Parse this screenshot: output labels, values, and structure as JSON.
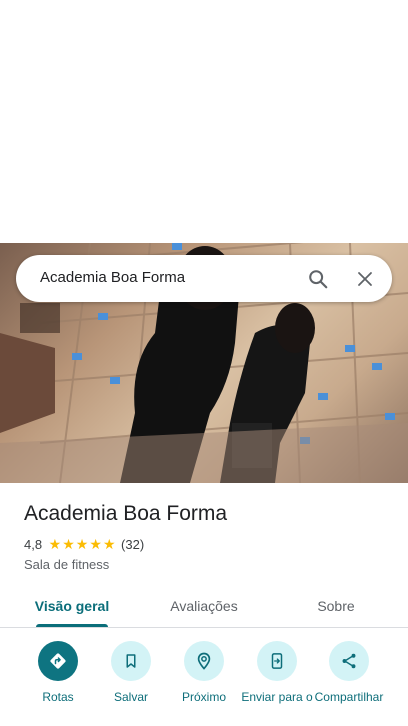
{
  "search": {
    "query": "Academia Boa Forma"
  },
  "place": {
    "name": "Academia Boa Forma",
    "rating": "4,8",
    "stars_count": 5,
    "review_count": "(32)",
    "category": "Sala de fitness"
  },
  "tabs": [
    {
      "label": "Visão geral",
      "active": true
    },
    {
      "label": "Avaliações",
      "active": false
    },
    {
      "label": "Sobre",
      "active": false
    }
  ],
  "actions": [
    {
      "label": "Rotas",
      "icon": "directions-icon",
      "primary": true
    },
    {
      "label": "Salvar",
      "icon": "bookmark-icon",
      "primary": false
    },
    {
      "label": "Próximo",
      "icon": "nearby-icon",
      "primary": false
    },
    {
      "label": "Enviar para o",
      "icon": "send-to-phone-icon",
      "primary": false
    },
    {
      "label": "Compartilhar",
      "icon": "share-icon",
      "primary": false
    }
  ],
  "colors": {
    "accent": "#0b6e7a",
    "action_bg": "#d3f3f6",
    "primary_action_bg": "#0e7481",
    "star": "#fbbc04"
  }
}
